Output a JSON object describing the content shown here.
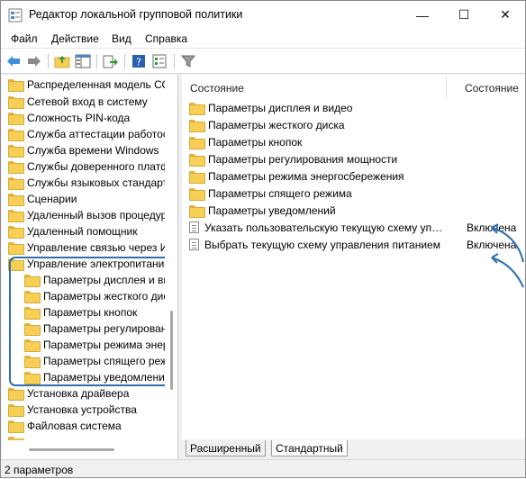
{
  "window": {
    "title": "Редактор локальной групповой политики",
    "controls": {
      "minimize": "—",
      "maximize": "☐",
      "close": "✕"
    }
  },
  "menu": [
    "Файл",
    "Действие",
    "Вид",
    "Справка"
  ],
  "tree": {
    "items": [
      "Распределенная модель СО",
      "Сетевой вход в систему",
      "Сложность PIN-кода",
      "Служба аттестации работоспособности",
      "Служба времени Windows",
      "Службы доверенного платформенного",
      "Службы языковых стандартов",
      "Сценарии",
      "Удаленный вызов процедур",
      "Удаленный помощник",
      "Управление связью через Интернет",
      "Управление электропитанием"
    ],
    "children": [
      "Параметры дисплея и видео",
      "Параметры жесткого диска",
      "Параметры кнопок",
      "Параметры регулирования мощности",
      "Параметры режима энергосбережения",
      "Параметры спящего режима",
      "Параметры уведомлений"
    ],
    "after": [
      "Установка драйвера",
      "Установка устройства",
      "Файловая система"
    ]
  },
  "list": {
    "columns": {
      "name": "Состояние",
      "state": "Состояние"
    },
    "folders": [
      "Параметры дисплея и видео",
      "Параметры жесткого диска",
      "Параметры кнопок",
      "Параметры регулирования мощности",
      "Параметры режима энергосбережения",
      "Параметры спящего режима",
      "Параметры уведомлений"
    ],
    "settings": [
      {
        "name": "Указать пользовательскую текущую схему управления питанием",
        "state": "Включена"
      },
      {
        "name": "Выбрать текущую схему управления питанием",
        "state": "Включена"
      }
    ]
  },
  "tabs": [
    "Расширенный",
    "Стандартный"
  ],
  "status": "2 параметров",
  "colors": {
    "highlight": "#2f6fb0",
    "folder": "#f6cf55"
  }
}
